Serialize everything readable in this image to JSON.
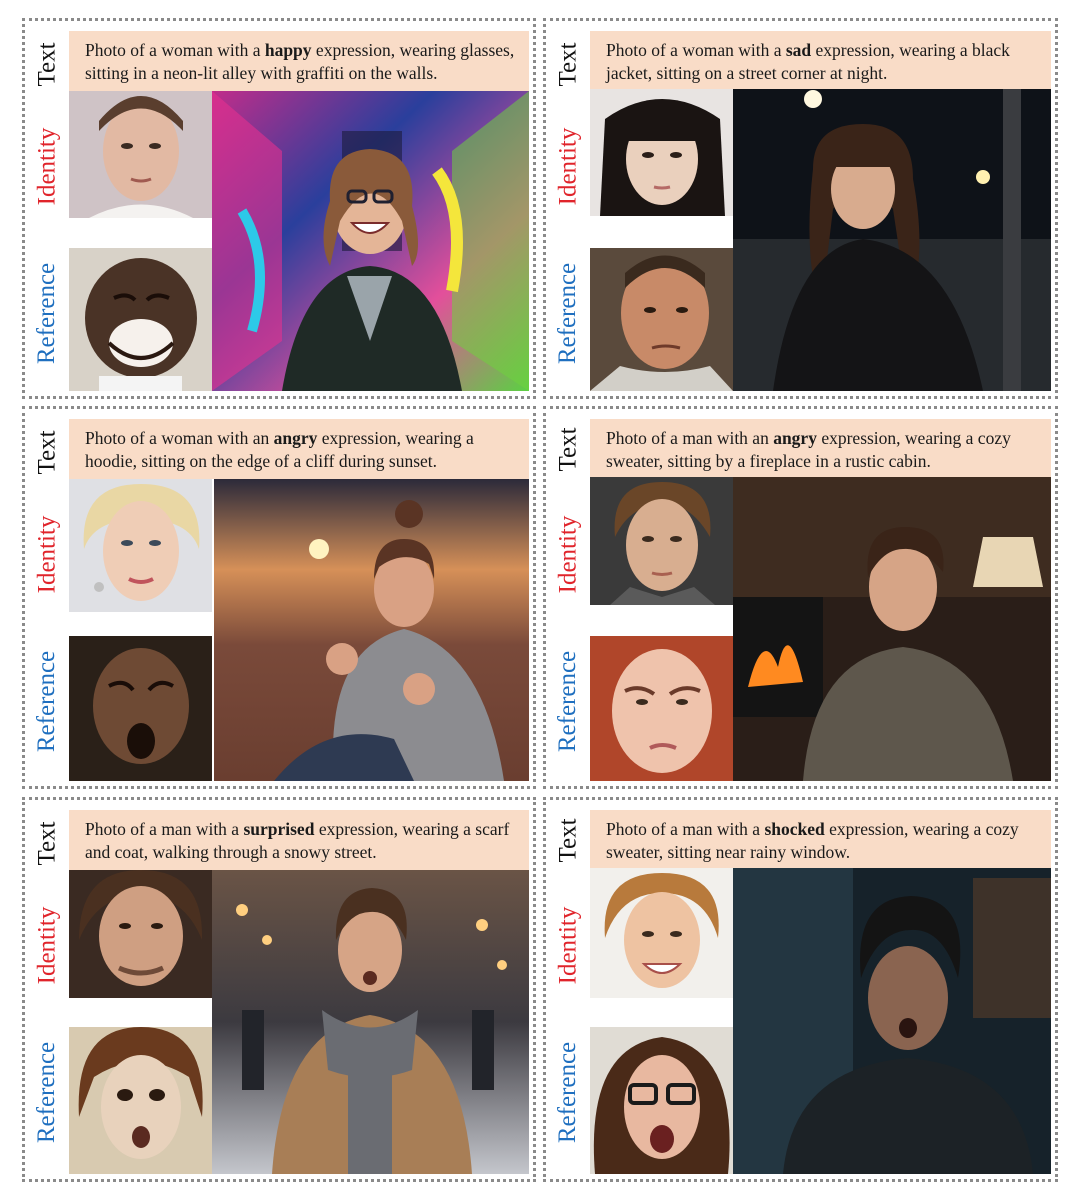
{
  "labels": {
    "text": "Text",
    "identity": "Identity",
    "reference": "Reference"
  },
  "colors": {
    "text_label": "#111111",
    "identity_label": "#e0242b",
    "reference_label": "#1f6fbf",
    "caption_background": "#f9dcc7",
    "panel_border": "#8a8a8a"
  },
  "panels": [
    {
      "caption_pre": "Photo of a woman with a ",
      "caption_keyword": "happy",
      "caption_post": " expression, wearing glasses, sitting in a neon-lit alley with graffiti on the walls."
    },
    {
      "caption_pre": "Photo of a woman with a ",
      "caption_keyword": "sad",
      "caption_post": " expression, wearing a black jacket, sitting on a street corner at night."
    },
    {
      "caption_pre": "Photo of a woman with an ",
      "caption_keyword": "angry",
      "caption_post": " expression,  wearing a hoodie, sitting on the edge of a cliff during sunset."
    },
    {
      "caption_pre": "Photo of a man with an ",
      "caption_keyword": "angry",
      "caption_post": " expression, wearing a cozy sweater, sitting by a fireplace in a rustic cabin."
    },
    {
      "caption_pre": "Photo of a man with a ",
      "caption_keyword": "surprised",
      "caption_post": " expression, wearing a scarf and coat, walking through a snowy street."
    },
    {
      "caption_pre": "Photo of a man with a ",
      "caption_keyword": "shocked",
      "caption_post": " expression, wearing a cozy sweater, sitting near rainy window."
    }
  ]
}
